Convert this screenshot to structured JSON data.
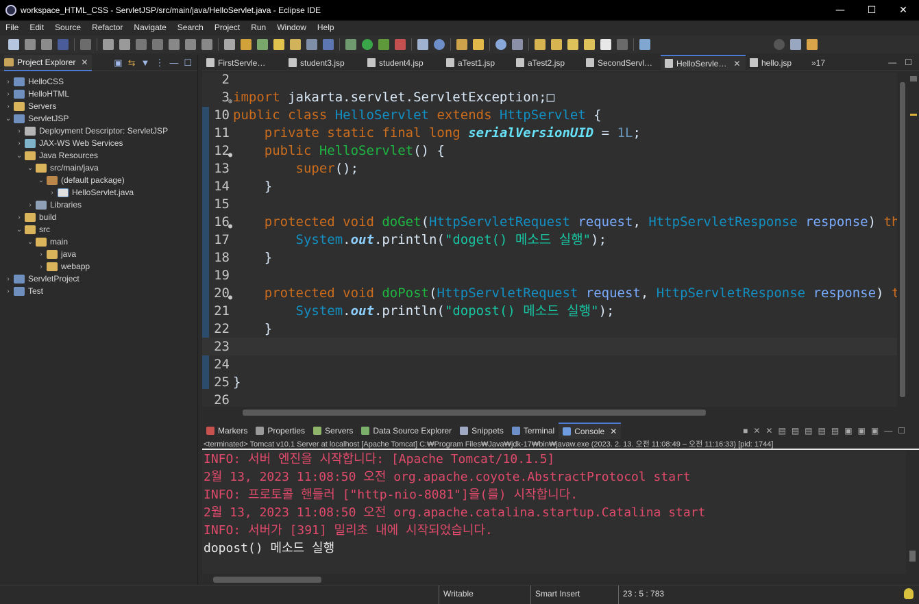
{
  "window": {
    "title": "workspace_HTML_CSS - ServletJSP/src/main/java/HelloServlet.java - Eclipse IDE",
    "minimize": "—",
    "maximize": "☐",
    "close": "✕"
  },
  "menu": [
    "File",
    "Edit",
    "Source",
    "Refactor",
    "Navigate",
    "Search",
    "Project",
    "Run",
    "Window",
    "Help"
  ],
  "explorer": {
    "tab_label": "Project Explorer",
    "tree": [
      {
        "label": "HelloCSS",
        "indent": 0,
        "arrow": "›",
        "icon": "proj"
      },
      {
        "label": "HelloHTML",
        "indent": 0,
        "arrow": "›",
        "icon": "proj"
      },
      {
        "label": "Servers",
        "indent": 0,
        "arrow": "›",
        "icon": "folder"
      },
      {
        "label": "ServletJSP",
        "indent": 0,
        "arrow": "⌄",
        "icon": "proj"
      },
      {
        "label": "Deployment Descriptor: ServletJSP",
        "indent": 1,
        "arrow": "›",
        "icon": "dd"
      },
      {
        "label": "JAX-WS Web Services",
        "indent": 1,
        "arrow": "›",
        "icon": "ws"
      },
      {
        "label": "Java Resources",
        "indent": 1,
        "arrow": "⌄",
        "icon": "folder"
      },
      {
        "label": "src/main/java",
        "indent": 2,
        "arrow": "⌄",
        "icon": "folder"
      },
      {
        "label": "(default package)",
        "indent": 3,
        "arrow": "⌄",
        "icon": "pkg"
      },
      {
        "label": "HelloServlet.java",
        "indent": 4,
        "arrow": "›",
        "icon": "java"
      },
      {
        "label": "Libraries",
        "indent": 2,
        "arrow": "›",
        "icon": "lib"
      },
      {
        "label": "build",
        "indent": 1,
        "arrow": "›",
        "icon": "folder"
      },
      {
        "label": "src",
        "indent": 1,
        "arrow": "⌄",
        "icon": "folder"
      },
      {
        "label": "main",
        "indent": 2,
        "arrow": "⌄",
        "icon": "folder"
      },
      {
        "label": "java",
        "indent": 3,
        "arrow": "›",
        "icon": "folder"
      },
      {
        "label": "webapp",
        "indent": 3,
        "arrow": "›",
        "icon": "folder"
      },
      {
        "label": "ServletProject",
        "indent": 0,
        "arrow": "›",
        "icon": "proj"
      },
      {
        "label": "Test",
        "indent": 0,
        "arrow": "›",
        "icon": "proj"
      }
    ]
  },
  "editor": {
    "tabs": [
      {
        "label": "FirstServle…",
        "active": false
      },
      {
        "label": "student3.jsp",
        "active": false
      },
      {
        "label": "student4.jsp",
        "active": false
      },
      {
        "label": "aTest1.jsp",
        "active": false
      },
      {
        "label": "aTest2.jsp",
        "active": false
      },
      {
        "label": "SecondServl…",
        "active": false
      },
      {
        "label": "HelloServle…",
        "active": true
      },
      {
        "label": "hello.jsp",
        "active": false
      }
    ],
    "overflow": "»17",
    "lines": [
      {
        "num": "2",
        "mark": "",
        "tokens": []
      },
      {
        "num": "3",
        "mark": "⊕",
        "tokens": [
          [
            "kw",
            "import"
          ],
          [
            "",
            " jakarta.servlet.ServletException;"
          ],
          [
            "",
            "□"
          ]
        ]
      },
      {
        "num": "10",
        "mark": "",
        "tokens": [
          [
            "kw",
            "public class "
          ],
          [
            "cls",
            "HelloServlet "
          ],
          [
            "kw",
            "extends "
          ],
          [
            "cls",
            "HttpServlet"
          ],
          [
            "",
            " {"
          ]
        ]
      },
      {
        "num": "11",
        "mark": "",
        "tokens": [
          [
            "",
            "    "
          ],
          [
            "kw",
            "private static final long "
          ],
          [
            "fld",
            "serialVersionUID"
          ],
          [
            "",
            " = "
          ],
          [
            "num",
            "1L"
          ],
          [
            "",
            ";"
          ]
        ]
      },
      {
        "num": "12",
        "mark": "●",
        "tokens": [
          [
            "",
            "    "
          ],
          [
            "kw",
            "public "
          ],
          [
            "typ",
            "HelloServlet"
          ],
          [
            "",
            "() {"
          ]
        ]
      },
      {
        "num": "13",
        "mark": "",
        "tokens": [
          [
            "",
            "        "
          ],
          [
            "kw",
            "super"
          ],
          [
            "",
            "();"
          ]
        ]
      },
      {
        "num": "14",
        "mark": "",
        "tokens": [
          [
            "",
            "    }"
          ]
        ]
      },
      {
        "num": "15",
        "mark": "",
        "tokens": []
      },
      {
        "num": "16",
        "mark": "●",
        "tokens": [
          [
            "",
            "    "
          ],
          [
            "kw",
            "protected void "
          ],
          [
            "typ",
            "doGet"
          ],
          [
            "",
            "("
          ],
          [
            "cls",
            "HttpServletRequest "
          ],
          [
            "par",
            "request"
          ],
          [
            "",
            ", "
          ],
          [
            "cls",
            "HttpServletResponse "
          ],
          [
            "par",
            "response"
          ],
          [
            "",
            ") "
          ],
          [
            "kw",
            "throw"
          ]
        ]
      },
      {
        "num": "17",
        "mark": "",
        "tokens": [
          [
            "",
            "        "
          ],
          [
            "sys",
            "System"
          ],
          [
            "",
            "."
          ],
          [
            "stat",
            "out"
          ],
          [
            "",
            ".println("
          ],
          [
            "str",
            "\"doget() 메소드 실행\""
          ],
          [
            "",
            ");"
          ]
        ]
      },
      {
        "num": "18",
        "mark": "",
        "tokens": [
          [
            "",
            "    }"
          ]
        ]
      },
      {
        "num": "19",
        "mark": "",
        "tokens": []
      },
      {
        "num": "20",
        "mark": "●",
        "tokens": [
          [
            "",
            "    "
          ],
          [
            "kw",
            "protected void "
          ],
          [
            "typ",
            "doPost"
          ],
          [
            "",
            "("
          ],
          [
            "cls",
            "HttpServletRequest "
          ],
          [
            "par",
            "request"
          ],
          [
            "",
            ", "
          ],
          [
            "cls",
            "HttpServletResponse "
          ],
          [
            "par",
            "response"
          ],
          [
            "",
            ") "
          ],
          [
            "kw",
            "thro"
          ]
        ]
      },
      {
        "num": "21",
        "mark": "",
        "tokens": [
          [
            "",
            "        "
          ],
          [
            "sys",
            "System"
          ],
          [
            "",
            "."
          ],
          [
            "stat",
            "out"
          ],
          [
            "",
            ".println("
          ],
          [
            "str",
            "\"dopost() 메소드 실행\""
          ],
          [
            "",
            ");"
          ]
        ]
      },
      {
        "num": "22",
        "mark": "",
        "tokens": [
          [
            "",
            "    }"
          ]
        ]
      },
      {
        "num": "23",
        "mark": "",
        "tokens": [],
        "current": true
      },
      {
        "num": "24",
        "mark": "",
        "tokens": []
      },
      {
        "num": "25",
        "mark": "",
        "tokens": [
          [
            "",
            "}"
          ]
        ]
      },
      {
        "num": "26",
        "mark": "",
        "tokens": []
      }
    ]
  },
  "console": {
    "tabs": [
      {
        "label": "Markers",
        "active": false,
        "color": "#c8524e"
      },
      {
        "label": "Properties",
        "active": false,
        "color": "#9a9a9a"
      },
      {
        "label": "Servers",
        "active": false,
        "color": "#8fb56a"
      },
      {
        "label": "Data Source Explorer",
        "active": false,
        "color": "#7ab06a"
      },
      {
        "label": "Snippets",
        "active": false,
        "color": "#9fa9c4"
      },
      {
        "label": "Terminal",
        "active": false,
        "color": "#6d8fc9"
      },
      {
        "label": "Console",
        "active": true,
        "color": "#6f9be0"
      }
    ],
    "status": "<terminated> Tomcat v10.1 Server at localhost [Apache Tomcat] C:₩Program Files₩Java₩jdk-17₩bin₩javaw.exe  (2023. 2. 13. 오전 11:08:49 – 오전 11:16:33) [pid: 1744]",
    "output": [
      {
        "text": "INFO: 서버 엔진을 시작합니다: [Apache Tomcat/10.1.5]",
        "type": "err"
      },
      {
        "text": "2월 13, 2023 11:08:50 오전 org.apache.coyote.AbstractProtocol start",
        "type": "err"
      },
      {
        "text": "INFO: 프로토콜 핸들러 [\"http-nio-8081\"]을(를) 시작합니다.",
        "type": "err"
      },
      {
        "text": "2월 13, 2023 11:08:50 오전 org.apache.catalina.startup.Catalina start",
        "type": "err"
      },
      {
        "text": "INFO: 서버가 [391] 밀리초 내에 시작되었습니다.",
        "type": "err"
      },
      {
        "text": "dopost() 메소드 실행",
        "type": "out"
      }
    ]
  },
  "statusbar": {
    "writable": "Writable",
    "insert_mode": "Smart Insert",
    "position": "23 : 5 : 783"
  }
}
